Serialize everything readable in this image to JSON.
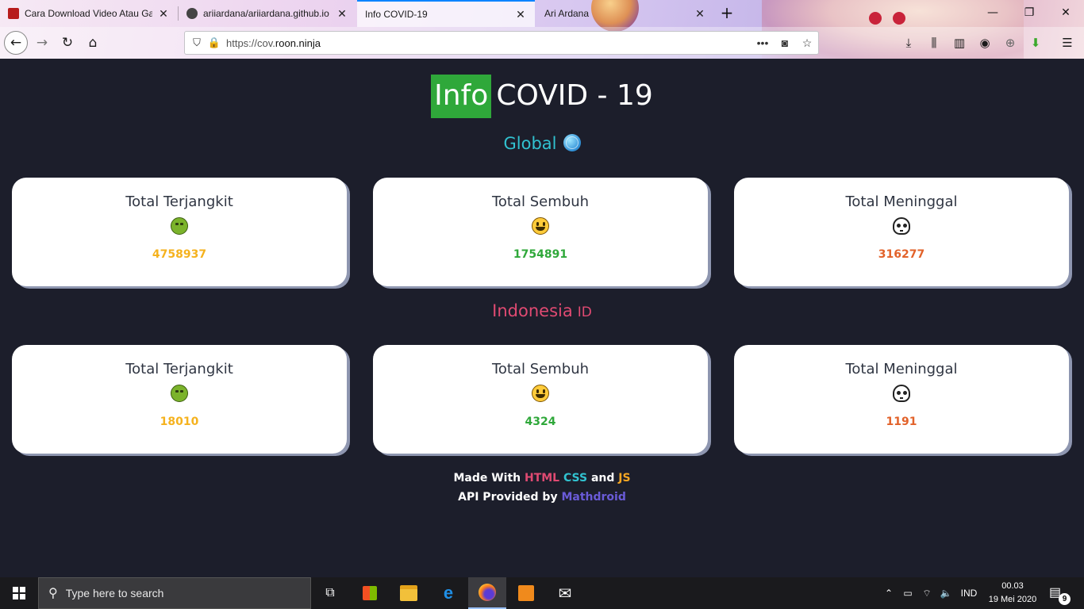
{
  "browser": {
    "tabs": [
      {
        "title": "Cara Download Video Atau Gan",
        "favicon_color": "#b71c1c"
      },
      {
        "title": "ariiardana/ariiardana.github.io",
        "favicon_color": "#444444"
      },
      {
        "title": "Info COVID-19",
        "favicon_color": "#6aa0e6"
      },
      {
        "title": "Ari Ardana",
        "favicon_color": "#7a6bd6"
      }
    ],
    "active_tab_index": 2,
    "url_prefix": "https://cov.",
    "url_domain": "roon.ninja",
    "icons": {
      "back": "arrow-left-icon",
      "forward": "arrow-right-icon",
      "reload": "reload-icon",
      "home": "home-icon",
      "shield": "shield-icon",
      "lock": "lock-icon",
      "more": "ellipsis-icon",
      "pocket": "pocket-icon",
      "bookmark": "star-icon",
      "download": "download-icon",
      "library": "library-icon",
      "sidebar": "sidebar-icon",
      "account": "account-icon",
      "translate": "globe-icon",
      "addon": "arrow-down-green-icon",
      "menu": "hamburger-icon",
      "minimize": "minimize-icon",
      "maximize": "restore-icon",
      "close": "close-icon",
      "new_tab": "plus-icon"
    }
  },
  "page": {
    "heading": {
      "highlight": "Info",
      "rest": "COVID - 19"
    },
    "global": {
      "title": "Global",
      "icon": "globe-icon",
      "cards": [
        {
          "title": "Total Terjangkit",
          "emoji": "nauseated-face",
          "value": "4758937",
          "color": "yellow"
        },
        {
          "title": "Total Sembuh",
          "emoji": "grinning-face",
          "value": "1754891",
          "color": "green"
        },
        {
          "title": "Total Meninggal",
          "emoji": "skull",
          "value": "316277",
          "color": "orange"
        }
      ]
    },
    "indonesia": {
      "title": "Indonesia",
      "flag": "ID",
      "cards": [
        {
          "title": "Total Terjangkit",
          "emoji": "nauseated-face",
          "value": "18010",
          "color": "yellow"
        },
        {
          "title": "Total Sembuh",
          "emoji": "grinning-face",
          "value": "4324",
          "color": "green"
        },
        {
          "title": "Total Meninggal",
          "emoji": "skull",
          "value": "1191",
          "color": "orange"
        }
      ]
    },
    "footer": {
      "made_with": "Made With",
      "html": "HTML",
      "css": "CSS",
      "and": "and",
      "js": "JS",
      "api_by": "API Provided by",
      "api_name": "Mathdroid"
    },
    "colors": {
      "background": "#1c1e2b",
      "info_badge": "#2fa83a",
      "global": "#31c2d0",
      "indonesia": "#e04a72"
    }
  },
  "taskbar": {
    "search_placeholder": "Type here to search",
    "apps": [
      "task-view-icon",
      "store-icon",
      "file-explorer-icon",
      "edge-icon",
      "firefox-icon",
      "sublime-text-icon",
      "mail-icon"
    ],
    "language": "IND",
    "time": "00.03",
    "date": "19 Mei 2020",
    "notification_count": "9"
  }
}
